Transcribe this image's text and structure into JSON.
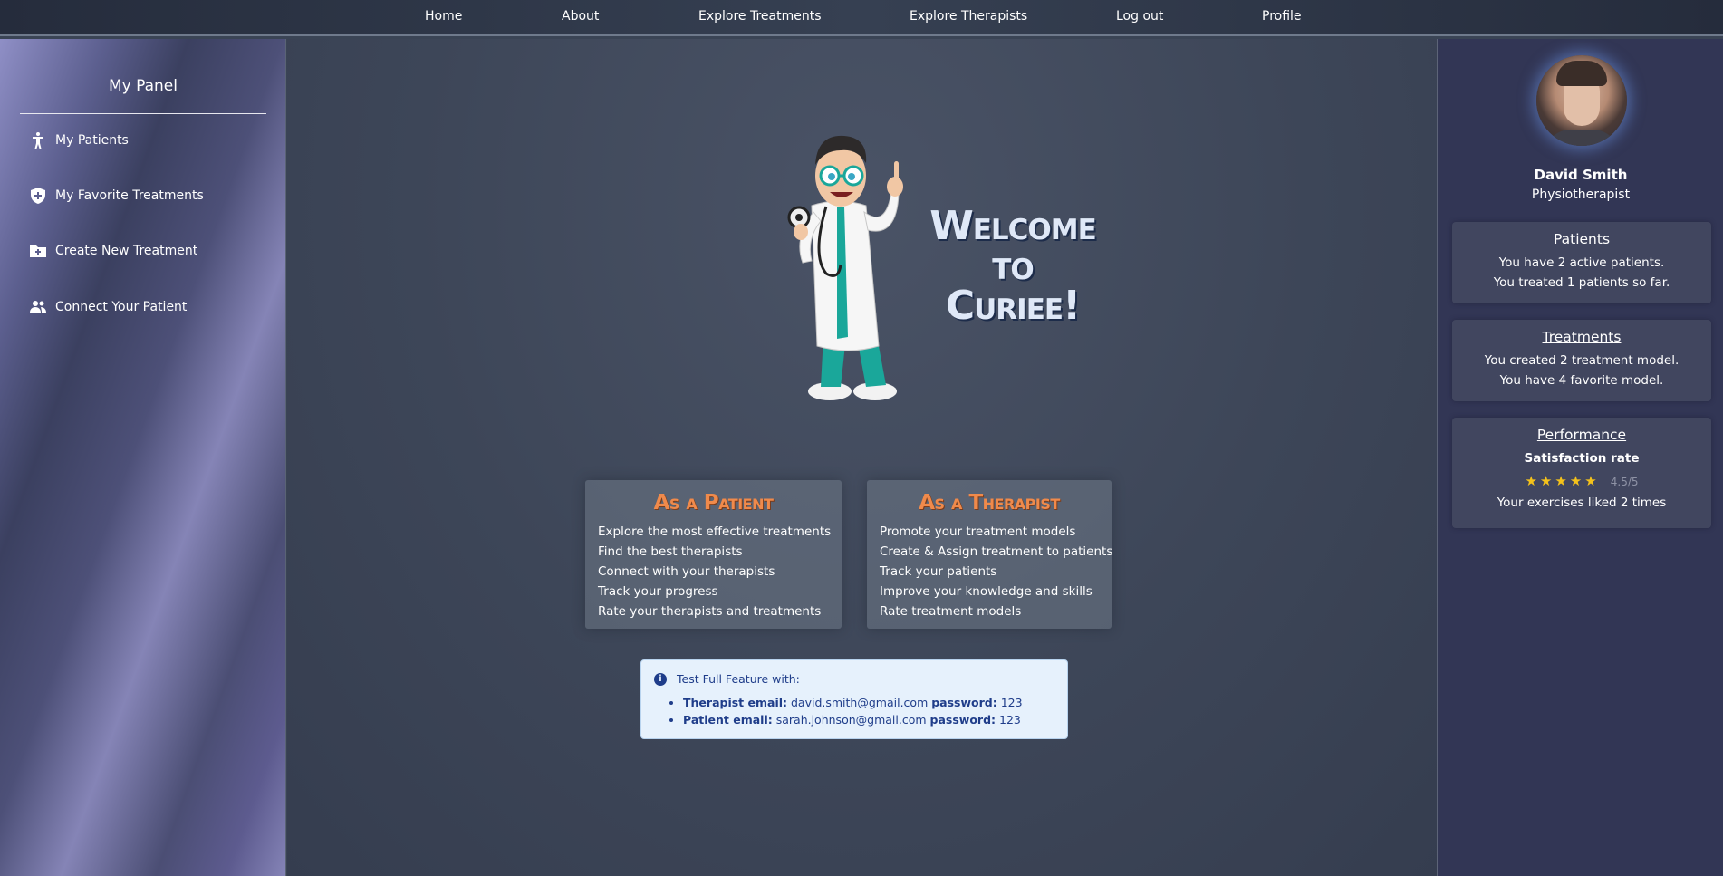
{
  "nav": {
    "items": [
      "Home",
      "About",
      "Explore Treatments",
      "Explore Therapists",
      "Log out",
      "Profile"
    ]
  },
  "sidebar": {
    "title": "My Panel",
    "items": [
      {
        "label": "My Patients",
        "icon": "person-icon"
      },
      {
        "label": "My Favorite Treatments",
        "icon": "shield-plus-icon"
      },
      {
        "label": "Create New Treatment",
        "icon": "folder-plus-icon"
      },
      {
        "label": "Connect Your Patient",
        "icon": "users-icon"
      }
    ]
  },
  "hero": {
    "welcome_line1": "Welcome",
    "welcome_line2": "to",
    "welcome_line3": "Curiee!",
    "illustration": "cartoon-doctor-with-stethoscope"
  },
  "patient_card": {
    "title": "As a Patient",
    "items": [
      "Explore the most effective treatments",
      "Find the best therapists",
      "Connect with your therapists",
      "Track your progress",
      "Rate your therapists and treatments"
    ]
  },
  "therapist_card": {
    "title": "As a Therapist",
    "items": [
      "Promote your treatment models",
      "Create & Assign treatment to patients",
      "Track your patients",
      "Improve your knowledge and skills",
      "Rate treatment models"
    ]
  },
  "info": {
    "heading": "Test Full Feature with:",
    "therapist_label": "Therapist email:",
    "therapist_email": "david.smith@gmail.com",
    "patient_label": "Patient email:",
    "patient_email": "sarah.johnson@gmail.com",
    "password_label": "password:",
    "password": "123"
  },
  "profile": {
    "name": "David Smith",
    "role": "Physiotherapist",
    "patients": {
      "title": "Patients",
      "line1": "You have 2 active patients.",
      "line2": "You treated 1 patients so far."
    },
    "treatments": {
      "title": "Treatments",
      "line1": "You created 2 treatment model.",
      "line2": "You have 4 favorite model."
    },
    "performance": {
      "title": "Performance",
      "subtitle": "Satisfaction rate",
      "stars": 5,
      "rating": "4.5/5",
      "line": "Your exercises liked 2 times"
    }
  },
  "colors": {
    "accent_orange": "#f08a4b",
    "star_yellow": "#f4c21b",
    "info_bg": "#e6f1fc",
    "info_text": "#1f3d8a"
  }
}
